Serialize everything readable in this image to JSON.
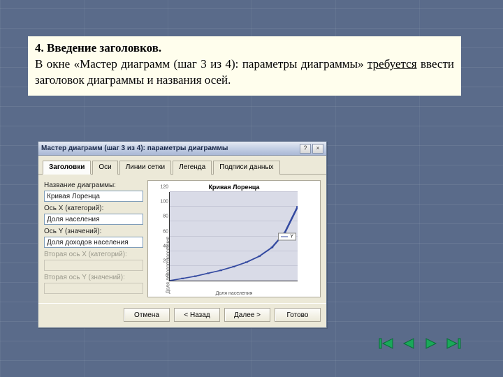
{
  "doc": {
    "heading": "4. Введение заголовков.",
    "sentence_part1": "В окне «Мастер диаграмм (шаг 3 из 4): параметры диаграммы» ",
    "sentence_underlined": "требуется",
    "sentence_part2": " ввести заголовок диаграммы и названия осей."
  },
  "wizard": {
    "title": "Мастер диаграмм (шаг 3 из 4): параметры диаграммы",
    "help_icon": "?",
    "close_icon": "×",
    "tabs": {
      "t0": "Заголовки",
      "t1": "Оси",
      "t2": "Линии сетки",
      "t3": "Легенда",
      "t4": "Подписи данных"
    },
    "labels": {
      "chart_name": "Название диаграммы:",
      "axis_x": "Ось X (категорий):",
      "axis_y": "Ось Y (значений):",
      "axis_x2": "Вторая ось X (категорий):",
      "axis_y2": "Вторая ось Y (значений):"
    },
    "values": {
      "chart_name": "Кривая Лоренца",
      "axis_x": "Доля населения",
      "axis_y": "Доля доходов населения",
      "axis_x2": "",
      "axis_y2": ""
    },
    "buttons": {
      "cancel": "Отмена",
      "back": "< Назад",
      "next": "Далее >",
      "finish": "Готово"
    }
  },
  "preview": {
    "title": "Кривая Лоренца",
    "ylabel": "Доля доходов населения",
    "xlabel": "Доля населения",
    "legend": "Y",
    "yticks": [
      "0",
      "20",
      "40",
      "60",
      "80",
      "100",
      "120"
    ]
  },
  "chart_data": {
    "type": "line",
    "title": "Кривая Лоренца",
    "xlabel": "Доля населения",
    "ylabel": "Доля доходов населения",
    "ylim": [
      0,
      120
    ],
    "series": [
      {
        "name": "Y",
        "x": [
          0,
          10,
          20,
          30,
          40,
          50,
          60,
          70,
          80,
          90,
          100
        ],
        "y": [
          0,
          3,
          6,
          10,
          14,
          19,
          25,
          33,
          45,
          65,
          100
        ]
      }
    ]
  },
  "nav": {
    "first": "first",
    "prev": "prev",
    "next": "next",
    "last": "last"
  },
  "colors": {
    "slide_bg": "#5a6b8a",
    "doc_bg": "#fffeed",
    "wizard_bg": "#ece9d8",
    "curve": "#3349a0",
    "plot_bg": "#d9dbe7",
    "nav_fill": "#1aa85a",
    "nav_stroke": "#0a6b38"
  }
}
